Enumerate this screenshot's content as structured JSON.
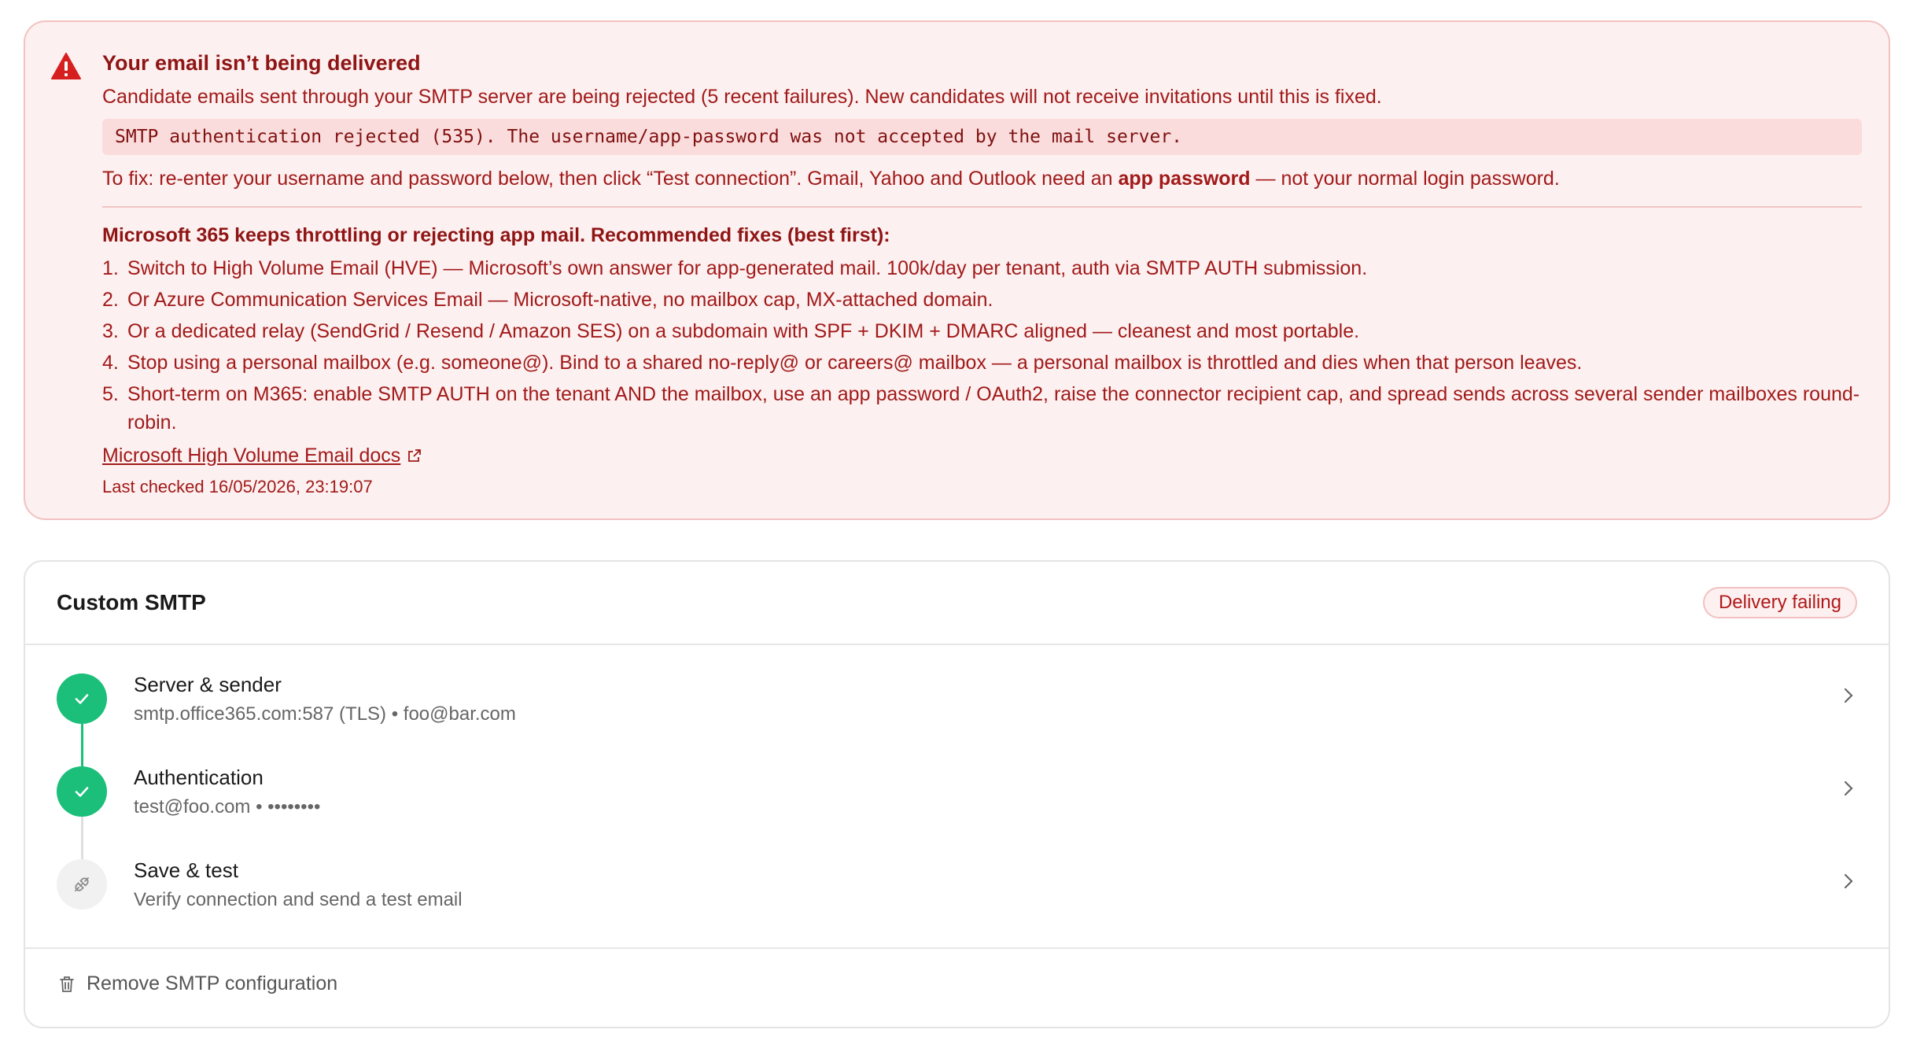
{
  "alert": {
    "title": "Your email isn’t being delivered",
    "description": "Candidate emails sent through your SMTP server are being rejected (5 recent failures). New candidates will not receive invitations until this is fixed.",
    "error_code": "SMTP authentication rejected (535). The username/app-password was not accepted by the mail server.",
    "fix_prefix": "To fix: re-enter your username and password below, then click “Test connection”. Gmail, Yahoo and Outlook need an ",
    "fix_bold": "app password",
    "fix_suffix": " — not your normal login password.",
    "fixes_title": "Microsoft 365 keeps throttling or rejecting app mail. Recommended fixes (best first):",
    "fixes": [
      {
        "num": "1.",
        "text": "Switch to High Volume Email (HVE) — Microsoft’s own answer for app-generated mail. 100k/day per tenant, auth via SMTP AUTH submission."
      },
      {
        "num": "2.",
        "text": "Or Azure Communication Services Email — Microsoft-native, no mailbox cap, MX-attached domain."
      },
      {
        "num": "3.",
        "text": "Or a dedicated relay (SendGrid / Resend / Amazon SES) on a subdomain with SPF + DKIM + DMARC aligned — cleanest and most portable."
      },
      {
        "num": "4.",
        "text": "Stop using a personal mailbox (e.g. someone@). Bind to a shared no-reply@ or careers@ mailbox — a personal mailbox is throttled and dies when that person leaves."
      },
      {
        "num": "5.",
        "text": "Short-term on M365: enable SMTP AUTH on the tenant AND the mailbox, use an app password / OAuth2, raise the connector recipient cap, and spread sends across several sender mailboxes round-robin."
      }
    ],
    "docs_link": "Microsoft High Volume Email docs",
    "last_checked": "Last checked 16/05/2026, 23:19:07"
  },
  "card": {
    "title": "Custom SMTP",
    "status": "Delivery failing",
    "steps": [
      {
        "title": "Server & sender",
        "subtitle": "smtp.office365.com:587 (TLS) • foo@bar.com",
        "state": "done"
      },
      {
        "title": "Authentication",
        "subtitle": "test@foo.com • ••••••••",
        "state": "done"
      },
      {
        "title": "Save & test",
        "subtitle": "Verify connection and send a test email",
        "state": "pending"
      }
    ],
    "remove_label": "Remove SMTP configuration"
  },
  "colors": {
    "alert_text": "#a11a1a",
    "alert_bg": "#fdf0f0",
    "success": "#1bbf7a"
  },
  "icons": {
    "alert": "warning-triangle-icon",
    "done": "check-icon",
    "pending": "plug-icon",
    "row": "chevron-right-icon",
    "remove": "trash-icon",
    "link": "external-link-icon"
  }
}
